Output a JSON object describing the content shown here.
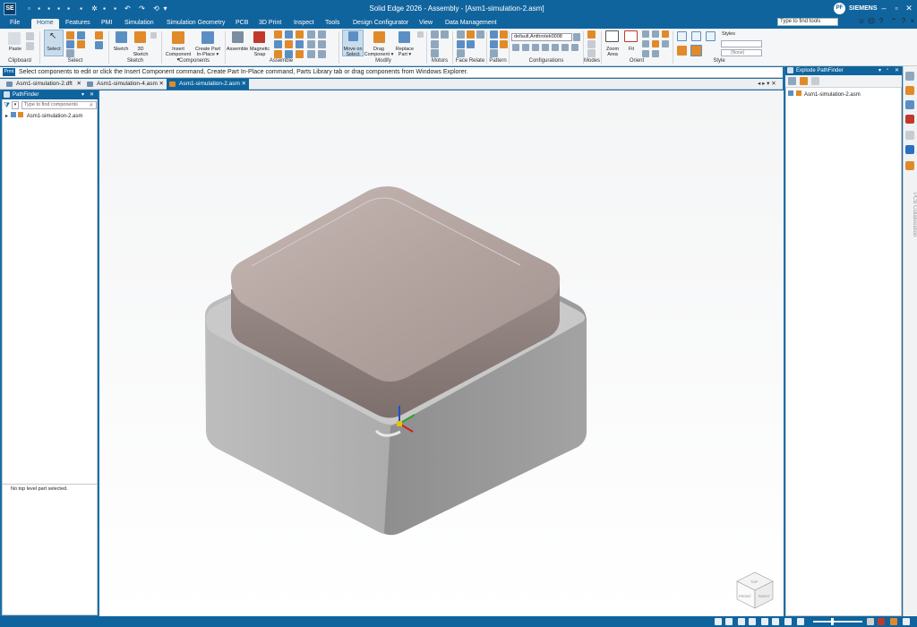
{
  "app": {
    "logo": "SE",
    "title": "Solid Edge 2026 - Assembly - [Asm1-simulation-2.asm]",
    "user_initials": "PF",
    "brand": "SIEMENS"
  },
  "menu": {
    "tabs": [
      "File",
      "Home",
      "Features",
      "PMI",
      "Simulation",
      "Simulation Geometry",
      "PCB",
      "3D Print",
      "Inspect",
      "Tools",
      "Design Configurator",
      "View",
      "Data Management"
    ],
    "active": "Home",
    "search_placeholder": "Type to find tools"
  },
  "ribbon": {
    "groups": {
      "clipboard": "Clipboard",
      "select": "Select",
      "sketch": "Sketch",
      "components": "Components",
      "assemble": "Assemble",
      "modify": "Modify",
      "motors": "Motors",
      "face_relate": "Face Relate",
      "pattern": "Pattern",
      "configurations": "Configurations",
      "modes": "Modes",
      "orient": "Orient",
      "style": "Style"
    },
    "buttons": {
      "paste": "Paste",
      "select": "Select",
      "sketch": "Sketch",
      "sketch3d_1": "3D",
      "sketch3d_2": "Sketch",
      "insert_component_1": "Insert",
      "insert_component_2": "Component ▾",
      "create_part_1": "Create Part",
      "create_part_2": "In-Place ▾",
      "assemble": "Assemble",
      "magnetic_snap_1": "Magnetic",
      "magnetic_snap_2": "Snap",
      "move_on_select_1": "Move on",
      "move_on_select_2": "Select",
      "drag_component_1": "Drag",
      "drag_component_2": "Component ▾",
      "replace_part_1": "Replace",
      "replace_part_2": "Part ▾",
      "zoom_area_1": "Zoom",
      "zoom_area_2": "Area",
      "fit": "Fit",
      "styles": "Styles"
    },
    "config_value": "default,Anthrotek0008",
    "style_none": "(None)"
  },
  "prompt": {
    "icon": "Prmt",
    "text": "Select components to edit or click the Insert Component command, Create Part In-Place command, Parts Library tab or drag components from Windows Explorer."
  },
  "doc_tabs": [
    {
      "label": "Asm1-simulation-2.dft",
      "close": "✕"
    },
    {
      "label": "Asm1-simulation-4.asm",
      "close": "✕"
    },
    {
      "label": "Asm1-simulation-2.asm",
      "close": "✕"
    }
  ],
  "doc_tab_nav": "◂ ▸ ▾ ✕",
  "pathfinder": {
    "title": "PathFinder",
    "search_placeholder": "Type to find components",
    "tree_root": "Asm1-simulation-2.asm",
    "status": "No top level part selected."
  },
  "explode": {
    "title": "Explode PathFinder",
    "tree_root": "Asm1-simulation-2.asm"
  },
  "dock": {
    "vertical_label": "PCB Collaboration"
  },
  "view_cube": {
    "top": "TOP",
    "front": "FRONT",
    "right": "RIGHT"
  },
  "colors": {
    "accent": "#10649e",
    "lid": "#a99894",
    "base": "#9e9e9e"
  }
}
